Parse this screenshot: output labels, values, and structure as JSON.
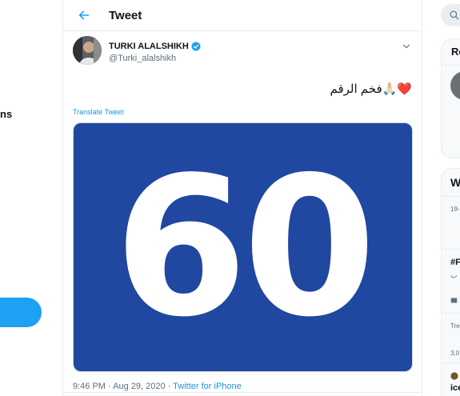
{
  "left_nav": {
    "fragment_text": "ns"
  },
  "header": {
    "title": "Tweet"
  },
  "tweet": {
    "author_name": "TURKI ALALSHIKH",
    "author_handle": "@Turki_alalshikh",
    "text": "فخم الرقم🙏🏻❤️",
    "translate_label": "Translate Tweet",
    "image_text": "60",
    "timestamp": "9:46 PM · Aug 29, 2020",
    "separator": " · ",
    "source": "Twitter for iPhone"
  },
  "right_column": {
    "card1_title": "Re",
    "card2_title": "W",
    "trend_meta_1": "19-",
    "trend_tag": "#F",
    "trend_sub": "ب",
    "trend_label": "Tre",
    "trend_count": "3,0",
    "trend_last": "ice"
  },
  "colors": {
    "accent": "#1da1f2",
    "media_background": "#2148a0"
  }
}
